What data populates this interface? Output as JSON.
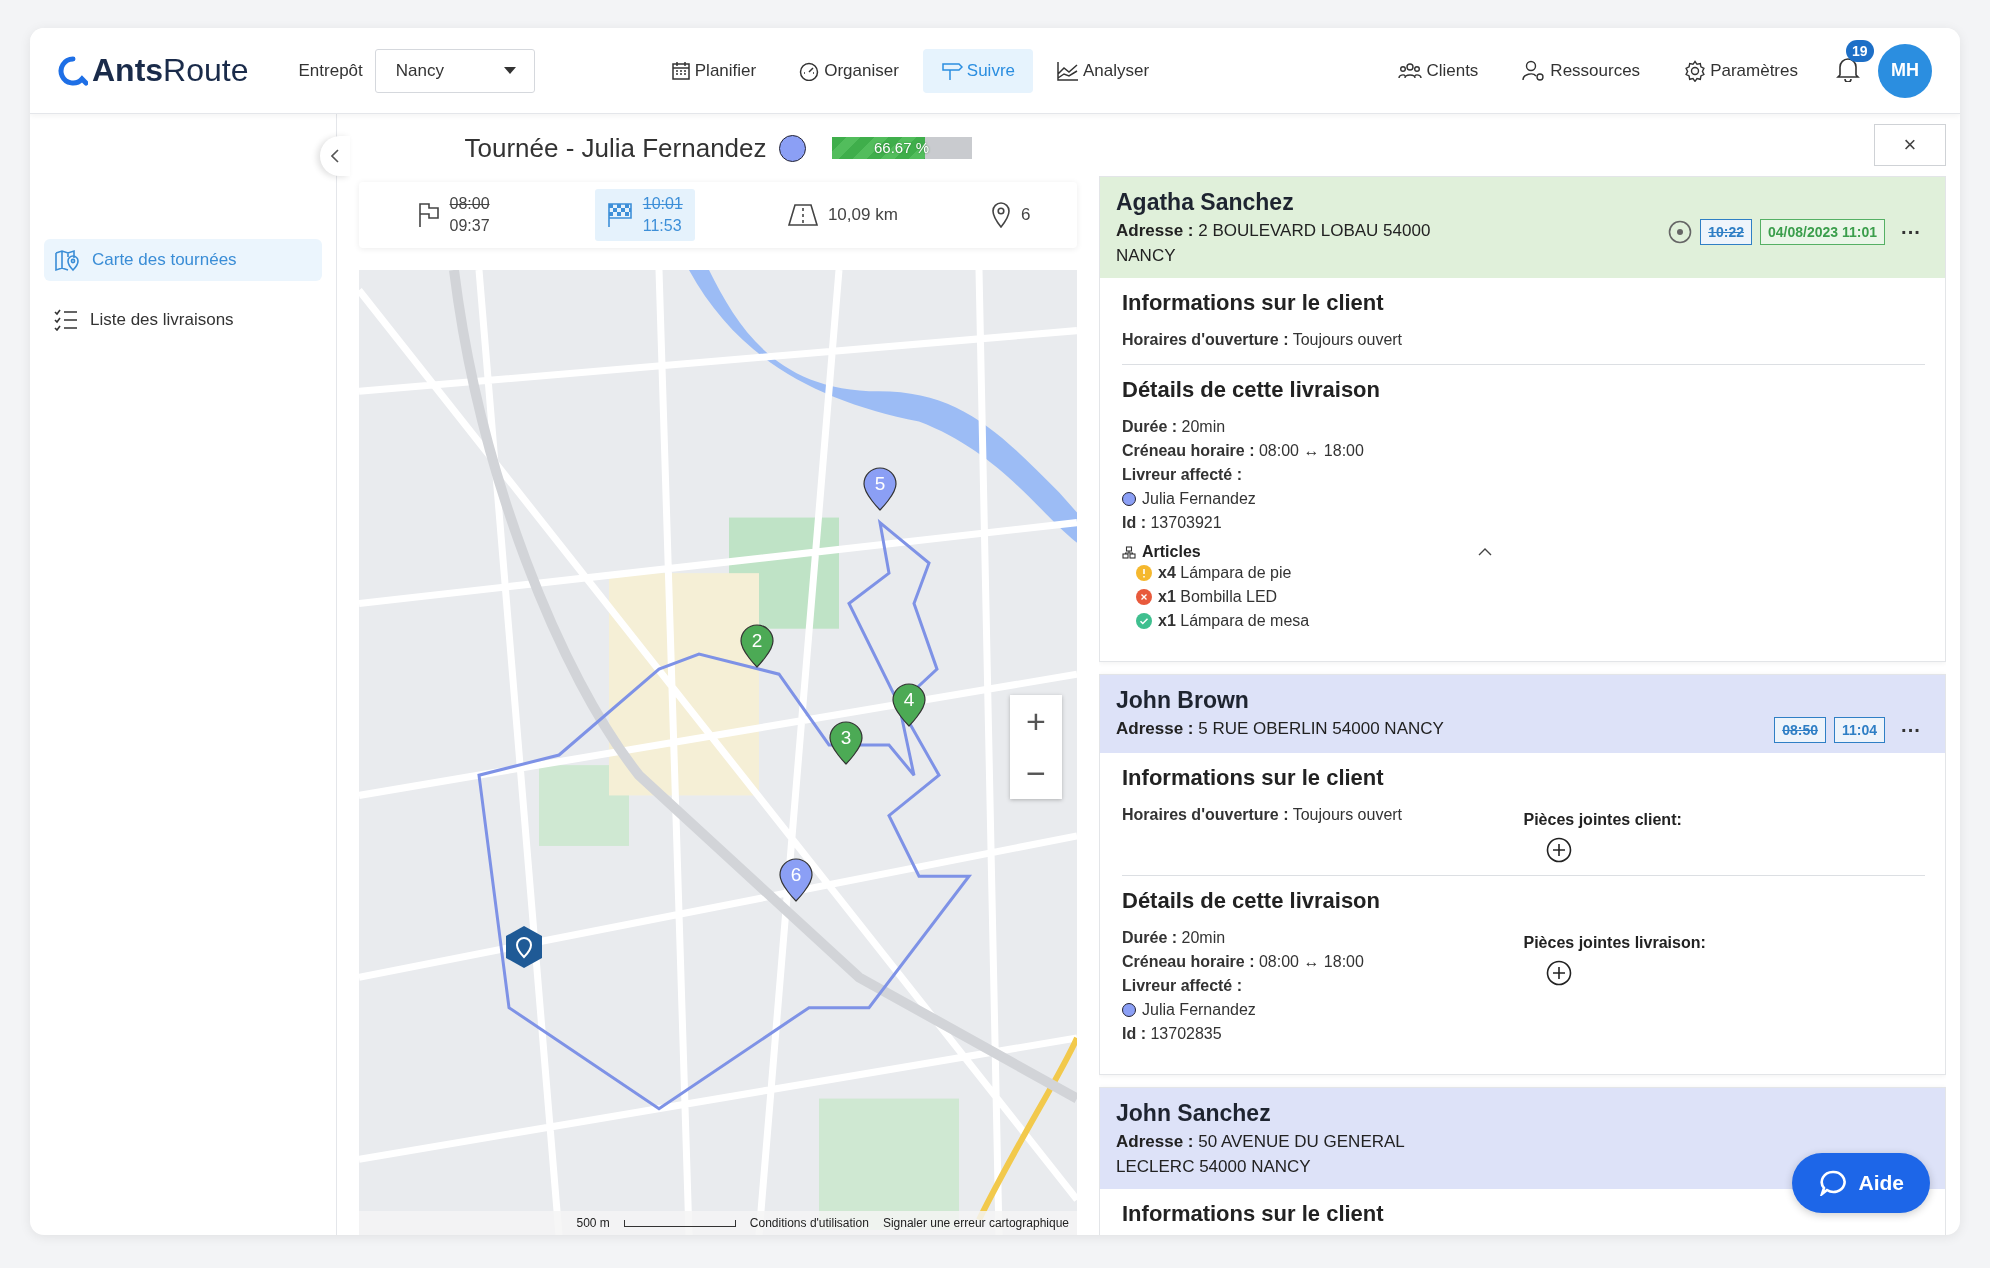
{
  "header": {
    "logo": "**Ants**Route",
    "warehouse_label": "Entrepôt",
    "warehouse": "Nancy",
    "nav": [
      {
        "label": "Planifier",
        "selected": false
      },
      {
        "label": "Organiser",
        "selected": false
      },
      {
        "label": "Suivre",
        "selected": true
      },
      {
        "label": "Analyser",
        "selected": false
      }
    ],
    "right_nav": [
      "Clients",
      "Ressources",
      "Paramètres"
    ],
    "notifications": "19",
    "avatar": "MH"
  },
  "sidebar": {
    "items": [
      {
        "label": "Carte des tournées",
        "selected": true
      },
      {
        "label": "Liste des livraisons",
        "selected": false
      }
    ]
  },
  "route": {
    "title": "Tournée - Julia Fernandez",
    "progress": {
      "level": 0.6667,
      "reading": "66.67 %"
    },
    "close": "×",
    "stats": [
      {
        "kind": "start",
        "planned": "08:00",
        "actual": "09:37",
        "selected": false
      },
      {
        "kind": "finish",
        "planned": "10:01",
        "actual": "11:53",
        "selected": true
      },
      {
        "kind": "distance",
        "value": "10,09 km"
      },
      {
        "kind": "stops",
        "value": "6"
      }
    ]
  },
  "map": {
    "markers": [
      {
        "label": "5",
        "delivered": false
      },
      {
        "label": "2",
        "delivered": true
      },
      {
        "label": "4",
        "delivered": true
      },
      {
        "label": "3",
        "delivered": true
      },
      {
        "label": "6",
        "delivered": false
      }
    ],
    "zoom_in": "+",
    "zoom_out": "−",
    "scale": "500 m",
    "terms": "Conditions d'utilisation",
    "report": "Signaler une erreur cartographique"
  },
  "deliveries": [
    {
      "name": "Agatha Sanchez",
      "delivered": true,
      "address": "**Adresse :** 2 BOULEVARD LOBAU 54000 NANCY",
      "planned_time": "10:22",
      "actual_time": "04/08/2023 11:01",
      "more": "···",
      "client_title": "Informations sur le client",
      "opening": "**Horaires d'ouverture :** Toujours ouvert",
      "details_title": "Détails de cette livraison",
      "details": [
        "**Durée :** 20min",
        "**Créneau horaire :** 08:00 ↔ 18:00",
        "**Livreur affecté :**"
      ],
      "driver": "Julia Fernandez",
      "id": "**Id :** 13703921",
      "articles": {
        "title": "Articles",
        "expanded": true,
        "items": [
          {
            "kind": "warning",
            "text": "**x4** Lámpara de pie"
          },
          {
            "kind": "error",
            "text": "**x1** Bombilla LED"
          },
          {
            "kind": "done",
            "text": "**x1** Lámpara de mesa"
          }
        ]
      }
    },
    {
      "name": "John Brown",
      "delivered": false,
      "address": "**Adresse :** 5 RUE OBERLIN 54000 NANCY",
      "planned_time": "08:50",
      "actual_time": "11:04",
      "more": "···",
      "client_title": "Informations sur le client",
      "opening": "**Horaires d'ouverture :** Toujours ouvert",
      "client_attachments": "Pièces jointes client:",
      "details_title": "Détails de cette livraison",
      "details": [
        "**Durée :** 20min",
        "**Créneau horaire :** 08:00 ↔ 18:00",
        "**Livreur affecté :**"
      ],
      "driver": "Julia Fernandez",
      "id": "**Id :** 13702835",
      "delivery_attachments": "Pièces jointes livraison:"
    },
    {
      "name": "John Sanchez",
      "delivered": false,
      "address": "**Adresse :** 50 AVENUE DU GENERAL LECLERC 54000 NANCY",
      "client_title": "Informations sur le client"
    }
  ],
  "help": "Aide"
}
